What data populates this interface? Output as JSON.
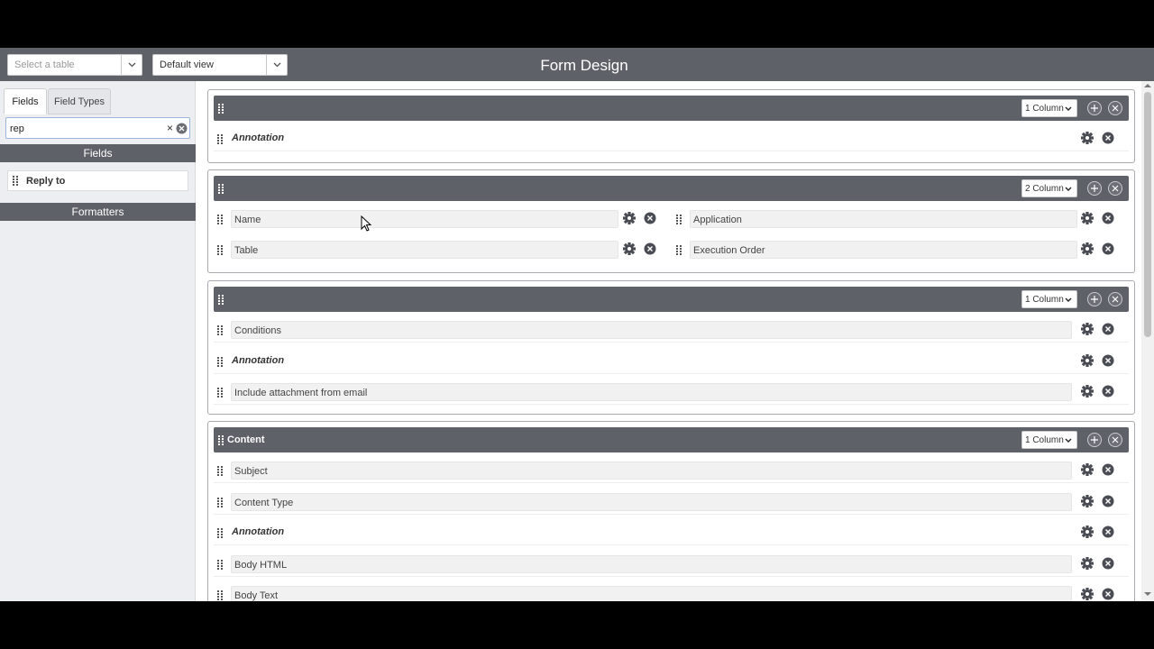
{
  "header": {
    "title": "Form Design",
    "table_select_placeholder": "Select a table",
    "view_select_value": "Default view"
  },
  "sidebar": {
    "tabs": [
      {
        "label": "Fields"
      },
      {
        "label": "Field Types"
      }
    ],
    "search_value": "rep",
    "clear_symbol": "×",
    "fields_header": "Fields",
    "results": [
      {
        "label": "Reply to"
      }
    ],
    "formatters_header": "Formatters"
  },
  "sections": [
    {
      "title": "",
      "columns": "1 Column",
      "fields": [
        {
          "label": "Annotation",
          "type": "annotation"
        }
      ]
    },
    {
      "title": "",
      "columns": "2 Column",
      "fields": [
        {
          "label": "Name"
        },
        {
          "label": "Application"
        },
        {
          "label": "Table"
        },
        {
          "label": "Execution Order"
        }
      ]
    },
    {
      "title": "",
      "columns": "1 Column",
      "fields": [
        {
          "label": "Conditions"
        },
        {
          "label": "Annotation",
          "type": "annotation"
        },
        {
          "label": "Include attachment from email"
        }
      ]
    },
    {
      "title": "Content",
      "columns": "1 Column",
      "fields": [
        {
          "label": "Subject"
        },
        {
          "label": "Content Type"
        },
        {
          "label": "Annotation",
          "type": "annotation"
        },
        {
          "label": "Body HTML"
        },
        {
          "label": "Body Text"
        }
      ]
    }
  ],
  "colors": {
    "header_bg": "#5f6169",
    "sidebar_bg": "#eceef1",
    "field_bg": "#f1f1f1",
    "icon_dark": "#4a4c53"
  },
  "icons": [
    "chevron-down-icon",
    "drag-handle-icon",
    "gear-icon",
    "close-circle-icon",
    "plus-circle-icon",
    "clear-icon",
    "mouse-cursor-icon"
  ]
}
